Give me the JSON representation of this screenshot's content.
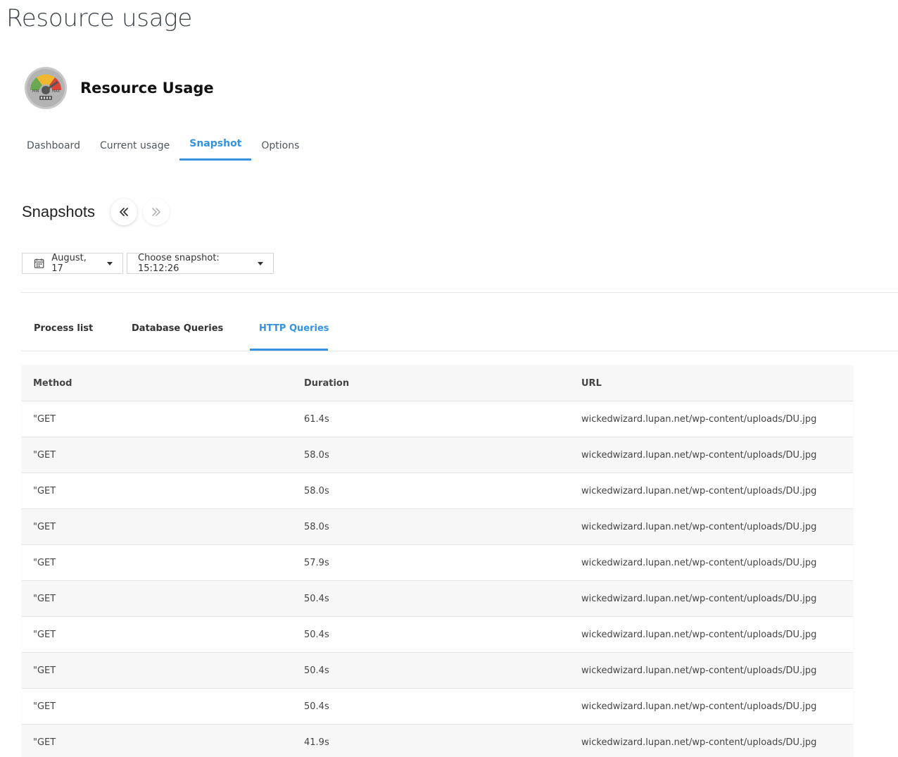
{
  "page": {
    "heading": "Resource usage"
  },
  "brand": {
    "title": "Resource Usage",
    "logo_icon": "gauge-icon",
    "logo_labels": {
      "min": "MIN",
      "max": "MAX"
    }
  },
  "main_tabs": [
    {
      "label": "Dashboard",
      "active": false
    },
    {
      "label": "Current usage",
      "active": false
    },
    {
      "label": "Snapshot",
      "active": true
    },
    {
      "label": "Options",
      "active": false
    }
  ],
  "snapshots": {
    "title": "Snapshots",
    "prev_icon": "double-chevron-left-icon",
    "next_icon": "double-chevron-right-icon"
  },
  "filters": {
    "date_label": "August, 17",
    "date_icon": "calendar-icon",
    "snapshot_label": "Choose snapshot: 15:12:26"
  },
  "sub_tabs": [
    {
      "label": "Process list",
      "active": false
    },
    {
      "label": "Database Queries",
      "active": false
    },
    {
      "label": "HTTP Queries",
      "active": true
    }
  ],
  "table": {
    "columns": [
      "Method",
      "Duration",
      "URL"
    ],
    "rows": [
      {
        "method": "\"GET",
        "duration": "61.4s",
        "url": "wickedwizard.lupan.net/wp-content/uploads/DU.jpg"
      },
      {
        "method": "\"GET",
        "duration": "58.0s",
        "url": "wickedwizard.lupan.net/wp-content/uploads/DU.jpg"
      },
      {
        "method": "\"GET",
        "duration": "58.0s",
        "url": "wickedwizard.lupan.net/wp-content/uploads/DU.jpg"
      },
      {
        "method": "\"GET",
        "duration": "58.0s",
        "url": "wickedwizard.lupan.net/wp-content/uploads/DU.jpg"
      },
      {
        "method": "\"GET",
        "duration": "57.9s",
        "url": "wickedwizard.lupan.net/wp-content/uploads/DU.jpg"
      },
      {
        "method": "\"GET",
        "duration": "50.4s",
        "url": "wickedwizard.lupan.net/wp-content/uploads/DU.jpg"
      },
      {
        "method": "\"GET",
        "duration": "50.4s",
        "url": "wickedwizard.lupan.net/wp-content/uploads/DU.jpg"
      },
      {
        "method": "\"GET",
        "duration": "50.4s",
        "url": "wickedwizard.lupan.net/wp-content/uploads/DU.jpg"
      },
      {
        "method": "\"GET",
        "duration": "50.4s",
        "url": "wickedwizard.lupan.net/wp-content/uploads/DU.jpg"
      },
      {
        "method": "\"GET",
        "duration": "41.9s",
        "url": "wickedwizard.lupan.net/wp-content/uploads/DU.jpg"
      }
    ]
  },
  "colors": {
    "accent": "#3493e0",
    "row_alt": "#f7f7f7",
    "border": "#e6e6e6"
  }
}
